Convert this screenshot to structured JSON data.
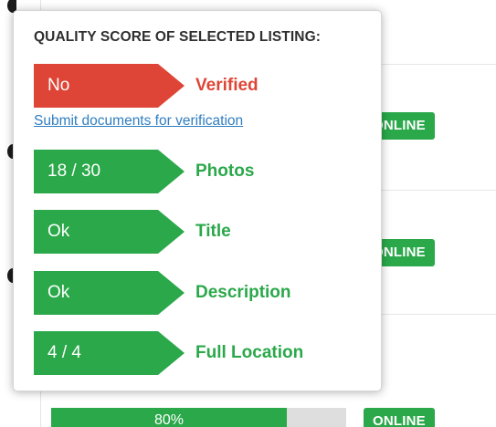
{
  "colors": {
    "green": "#2aa84a",
    "red": "#de4536",
    "link": "#2f7ec1",
    "track": "#dedede"
  },
  "popover": {
    "title": "QUALITY SCORE OF SELECTED LISTING:",
    "verify_link": "Submit documents for verification",
    "rows": [
      {
        "value": "No",
        "label": "Verified",
        "status": "bad"
      },
      {
        "value": "18 / 30",
        "label": "Photos",
        "status": "good"
      },
      {
        "value": "Ok",
        "label": "Title",
        "status": "good"
      },
      {
        "value": "Ok",
        "label": "Description",
        "status": "good"
      },
      {
        "value": "4 / 4",
        "label": "Full Location",
        "status": "good"
      }
    ]
  },
  "background": {
    "status_badges": [
      "ONLINE",
      "ONLINE",
      "ONLINE"
    ],
    "progress": {
      "text": "80%",
      "value": 0.8
    }
  }
}
